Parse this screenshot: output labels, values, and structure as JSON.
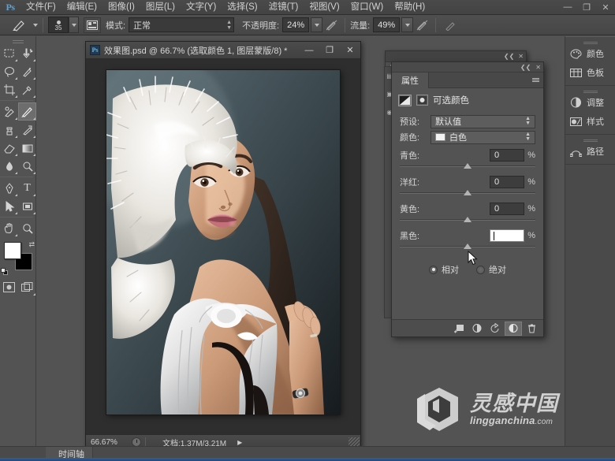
{
  "app": {
    "name": "Photoshop",
    "logo": "Ps"
  },
  "menubar": {
    "items": [
      {
        "label": "文件(F)",
        "name": "menu-file"
      },
      {
        "label": "编辑(E)",
        "name": "menu-edit"
      },
      {
        "label": "图像(I)",
        "name": "menu-image"
      },
      {
        "label": "图层(L)",
        "name": "menu-layer"
      },
      {
        "label": "文字(Y)",
        "name": "menu-type"
      },
      {
        "label": "选择(S)",
        "name": "menu-select"
      },
      {
        "label": "滤镜(T)",
        "name": "menu-filter"
      },
      {
        "label": "视图(V)",
        "name": "menu-view"
      },
      {
        "label": "窗口(W)",
        "name": "menu-window"
      },
      {
        "label": "帮助(H)",
        "name": "menu-help"
      }
    ],
    "window_controls": {
      "minimize": "—",
      "restore": "❐",
      "close": "✕"
    }
  },
  "options_bar": {
    "brush_size": "35",
    "mode_label": "模式:",
    "mode_value": "正常",
    "opacity_label": "不透明度:",
    "opacity_value": "24%",
    "flow_label": "流量:",
    "flow_value": "49%"
  },
  "toolbox": {
    "tools": [
      {
        "name": "tool-rectangular-marquee",
        "glyph": "▣",
        "active": false
      },
      {
        "name": "tool-move",
        "glyph": "⊹",
        "active": false
      },
      {
        "name": "tool-lasso",
        "glyph": "◯",
        "active": false
      },
      {
        "name": "tool-quick-selection",
        "glyph": "✎",
        "active": false
      },
      {
        "name": "tool-crop",
        "glyph": "⌗",
        "active": false
      },
      {
        "name": "tool-eyedropper",
        "glyph": "⚲",
        "active": false
      },
      {
        "name": "tool-spot-healing-brush",
        "glyph": "⌁",
        "active": false
      },
      {
        "name": "tool-brush",
        "glyph": "✏",
        "active": true
      },
      {
        "name": "tool-clone-stamp",
        "glyph": "⎌",
        "active": false
      },
      {
        "name": "tool-history-brush",
        "glyph": "✒",
        "active": false
      },
      {
        "name": "tool-eraser",
        "glyph": "▱",
        "active": false
      },
      {
        "name": "tool-gradient",
        "glyph": "▤",
        "active": false
      },
      {
        "name": "tool-blur",
        "glyph": "💧",
        "active": false
      },
      {
        "name": "tool-dodge",
        "glyph": "🔍",
        "active": false
      },
      {
        "name": "tool-pen",
        "glyph": "✐",
        "active": false
      },
      {
        "name": "tool-type",
        "glyph": "T",
        "active": false
      },
      {
        "name": "tool-path-selection",
        "glyph": "➤",
        "active": false
      },
      {
        "name": "tool-rectangle",
        "glyph": "▭",
        "active": false
      },
      {
        "name": "tool-hand",
        "glyph": "✋",
        "active": false
      },
      {
        "name": "tool-zoom",
        "glyph": "⌕",
        "active": false
      }
    ],
    "foreground_color": "#ffffff",
    "background_color": "#000000",
    "quick_mask_name": "quick-mask-mode",
    "screen_mode_name": "screen-mode"
  },
  "document": {
    "title": "效果图.psd @ 66.7% (选取颜色 1, 图层蒙版/8) *",
    "icon": "Ps",
    "window_controls": {
      "minimize": "—",
      "maximize": "❐",
      "close": "✕"
    },
    "status": {
      "zoom": "66.67%",
      "doc_size": "文档:1.37M/3.21M",
      "arrow": "▶"
    }
  },
  "properties_panel": {
    "tab_label": "属性",
    "adjustment_name": "可选颜色",
    "preset_label": "预设:",
    "preset_value": "默认值",
    "colors_label": "颜色:",
    "colors_value": "白色",
    "color_chip": "#f2f2f2",
    "sliders": [
      {
        "label": "青色:",
        "value": "0",
        "unit": "%",
        "knob_pct": 50,
        "name": "cyan-slider",
        "focused": false
      },
      {
        "label": "洋红:",
        "value": "0",
        "unit": "%",
        "knob_pct": 50,
        "name": "magenta-slider",
        "focused": false
      },
      {
        "label": "黄色:",
        "value": "0",
        "unit": "%",
        "knob_pct": 50,
        "name": "yellow-slider",
        "focused": false
      },
      {
        "label": "黑色:",
        "value": "",
        "unit": "%",
        "knob_pct": 50,
        "name": "black-slider",
        "focused": true
      }
    ],
    "method": {
      "relative_label": "相对",
      "absolute_label": "绝对",
      "selected": "相对"
    },
    "footer_buttons": [
      {
        "name": "clip-to-layer-button",
        "glyph": "⊑",
        "active": false
      },
      {
        "name": "view-previous-state-button",
        "glyph": "◉",
        "active": false
      },
      {
        "name": "reset-adjustment-button",
        "glyph": "↺",
        "active": false
      },
      {
        "name": "toggle-layer-visibility-button",
        "glyph": "◑",
        "active": true
      },
      {
        "name": "delete-adjustment-button",
        "glyph": "🗑",
        "active": false
      }
    ]
  },
  "right_dock": {
    "groups": [
      {
        "items": [
          {
            "label": "颜色",
            "icon": "color-wheel-icon",
            "name": "dock-item-color"
          },
          {
            "label": "色板",
            "icon": "swatches-icon",
            "name": "dock-item-swatches"
          }
        ]
      },
      {
        "items": [
          {
            "label": "调整",
            "icon": "adjustments-icon",
            "name": "dock-item-adjustments"
          },
          {
            "label": "样式",
            "icon": "styles-icon",
            "name": "dock-item-styles"
          }
        ]
      },
      {
        "items": [
          {
            "label": "路径",
            "icon": "paths-icon",
            "name": "dock-item-paths"
          }
        ]
      }
    ]
  },
  "bottom_panel": {
    "tab_label": "时间轴"
  },
  "watermark": {
    "cn": "灵感中国",
    "en": "lingganchina",
    "domain": ".com"
  }
}
